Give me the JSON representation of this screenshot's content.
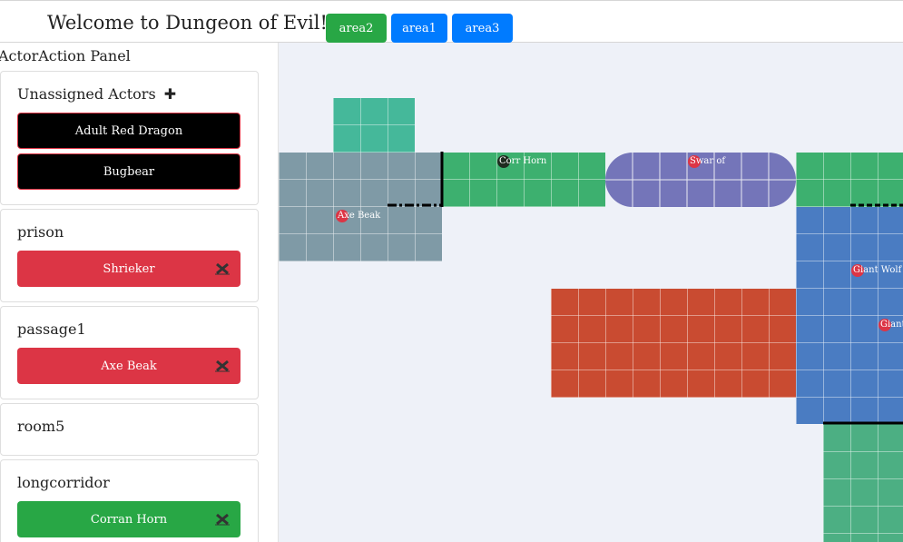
{
  "header": {
    "title": "Welcome to Dungeon of Evil!",
    "areas": [
      {
        "label": "area2",
        "color": "#28a745"
      },
      {
        "label": "area1",
        "color": "#007bff"
      },
      {
        "label": "area3",
        "color": "#007bff"
      }
    ]
  },
  "sidebar": {
    "panel_title": "ActorAction Panel",
    "unassigned": {
      "title": "Unassigned Actors",
      "add_icon": "plus-icon",
      "actors": [
        "Adult Red Dragon",
        "Bugbear"
      ]
    },
    "rooms": [
      {
        "name": "prison",
        "actors": [
          {
            "label": "Shrieker",
            "color": "red"
          }
        ]
      },
      {
        "name": "passage1",
        "actors": [
          {
            "label": "Axe Beak",
            "color": "red"
          }
        ]
      },
      {
        "name": "room5",
        "actors": []
      },
      {
        "name": "longcorridor",
        "actors": [
          {
            "label": "Corran Horn",
            "color": "green"
          }
        ]
      }
    ],
    "remove_icon": "close-x-icon"
  },
  "map": {
    "background": "#eef1f8",
    "tokens": [
      {
        "name": "axe-beak-token",
        "text": "Axe Beak"
      },
      {
        "name": "corran-horn-token",
        "text": "Corr Horn"
      },
      {
        "name": "swarm-token",
        "text": "Swar of"
      },
      {
        "name": "giant-wolf-token",
        "text": "Giant Wolf"
      },
      {
        "name": "giant-frog-token",
        "text": "Giant Frog"
      }
    ],
    "room_colors": {
      "teal": "#45b89a",
      "slate": "#7f9aa6",
      "green": "#3db06f",
      "purple": "#7475b9",
      "blue": "#4a7cc2",
      "orange": "#c94b31",
      "seagreen": "#4caf83"
    }
  }
}
